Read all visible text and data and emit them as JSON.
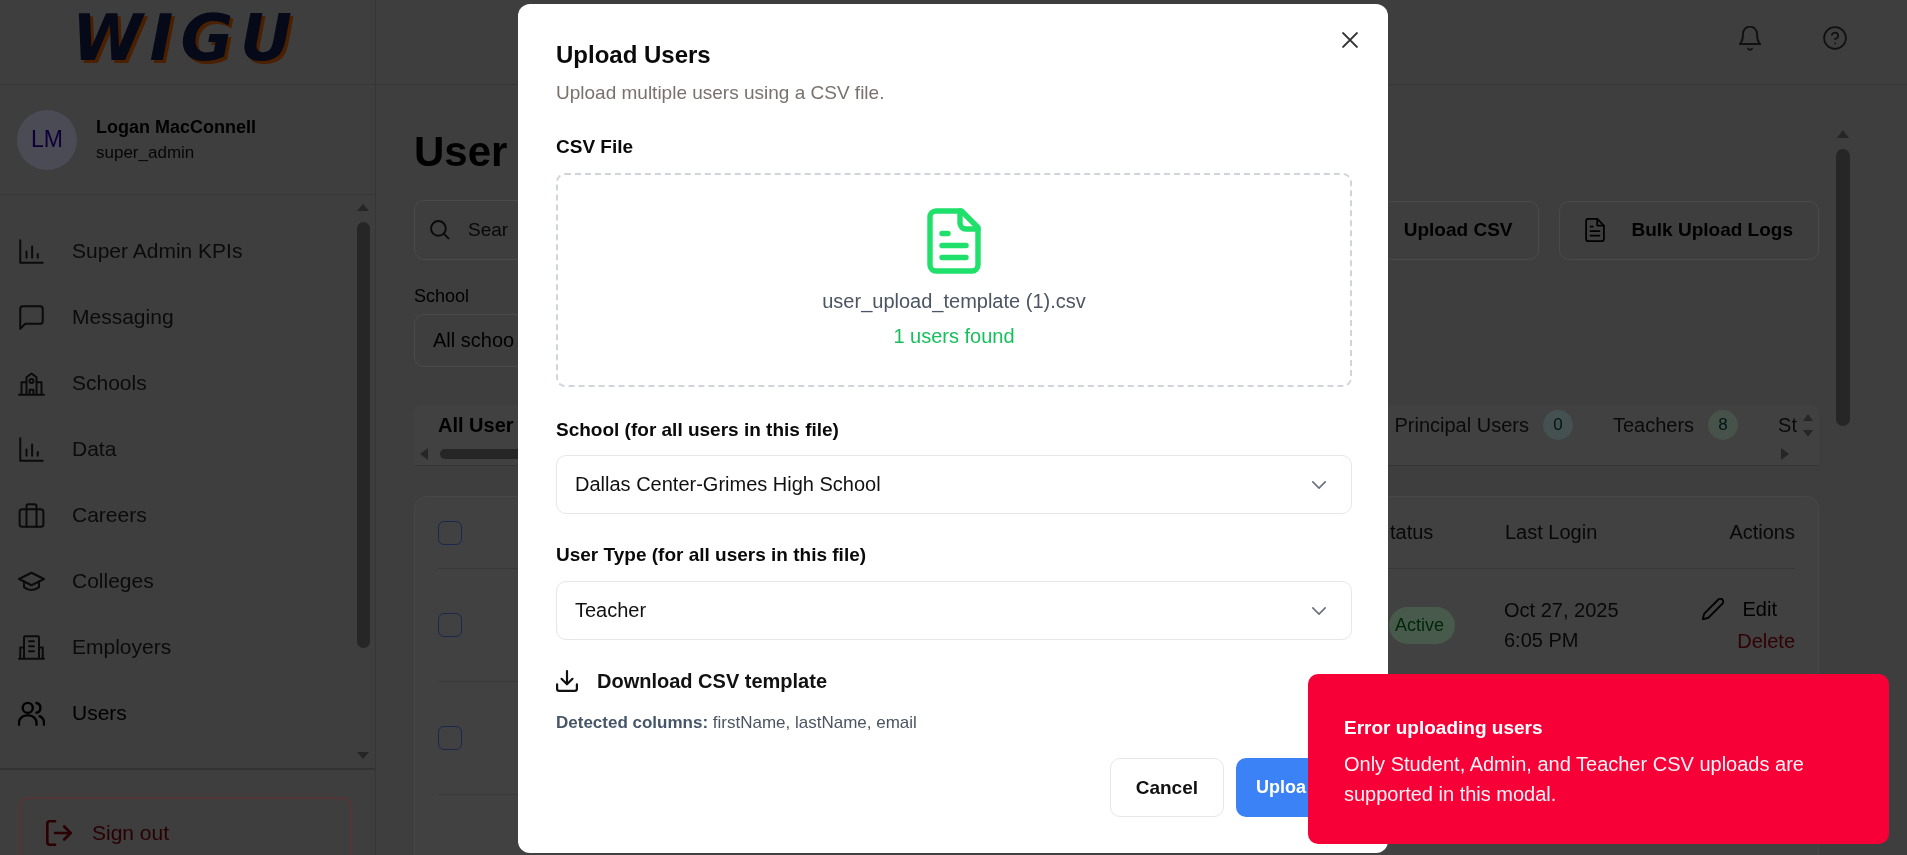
{
  "sidebar": {
    "logo": "WIGU",
    "user": {
      "initials": "LM",
      "name": "Logan MacConnell",
      "role": "super_admin"
    },
    "nav_items": [
      {
        "label": "Super Admin KPIs",
        "selected": false
      },
      {
        "label": "Messaging",
        "selected": false
      },
      {
        "label": "Schools",
        "selected": false
      },
      {
        "label": "Data",
        "selected": false
      },
      {
        "label": "Careers",
        "selected": false
      },
      {
        "label": "Colleges",
        "selected": false
      },
      {
        "label": "Employers",
        "selected": false
      },
      {
        "label": "Users",
        "selected": true
      }
    ],
    "sign_out": "Sign out"
  },
  "page": {
    "title": "User",
    "search": {
      "placeholder": "Sear"
    },
    "school_filter": {
      "label": "School",
      "value": "All schoo"
    },
    "actions": [
      {
        "label": "Upload CSV",
        "kind": "upload"
      },
      {
        "label": "Bulk Upload Logs",
        "kind": "logs"
      }
    ],
    "tabs": [
      {
        "label": "All User",
        "selected": true
      },
      {
        "label": "Principal Users",
        "count": "0",
        "color": "#455150",
        "selected": false
      },
      {
        "label": "Teachers",
        "count": "8",
        "color": "#46524a",
        "selected": false
      },
      {
        "label": "St",
        "selected": false
      }
    ],
    "table": {
      "select_all": {
        "checked": false
      },
      "columns": [
        "tatus",
        "Last Login",
        "Actions"
      ],
      "rows": [
        {
          "checked": false,
          "status": "Active",
          "last_login_date": "Oct 27, 2025",
          "last_login_time": "6:05 PM",
          "actions": [
            {
              "label": "Edit",
              "kind": "edit"
            },
            {
              "label": "Delete",
              "kind": "delete"
            }
          ]
        },
        {
          "checked": false
        }
      ]
    }
  },
  "modal": {
    "title": "Upload Users",
    "subtitle": "Upload multiple users using a CSV file.",
    "file_label": "CSV File",
    "file": {
      "name": "user_upload_template (1).csv",
      "status": "1 users found"
    },
    "school": {
      "label": "School (for all users in this file)",
      "value": "Dallas Center-Grimes High School"
    },
    "user_type": {
      "label": "User Type (for all users in this file)",
      "value": "Teacher"
    },
    "download_link": "Download CSV template",
    "detected_columns": "**Detected columns:** firstName, lastName, email",
    "buttons": [
      {
        "label": "Cancel",
        "kind": "secondary"
      },
      {
        "label": "Uploa",
        "kind": "primary"
      }
    ]
  },
  "toast": {
    "title": "Error uploading users",
    "message": "Only Student, Admin, and Teacher CSV uploads are supported in this modal."
  }
}
